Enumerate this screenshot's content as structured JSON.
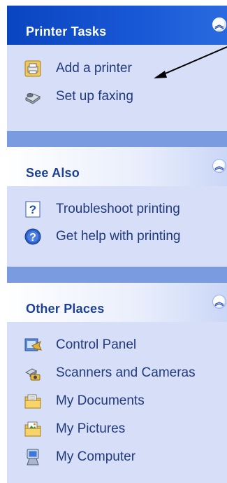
{
  "printer_tasks": {
    "title": "Printer Tasks",
    "collapse_glyph": "︽",
    "items": [
      {
        "label": "Add a printer",
        "icon": "add-printer-icon"
      },
      {
        "label": "Set up faxing",
        "icon": "fax-icon"
      }
    ]
  },
  "see_also": {
    "title": "See Also",
    "collapse_glyph": "︽",
    "items": [
      {
        "label": "Troubleshoot printing",
        "icon": "help-topic-icon"
      },
      {
        "label": "Get help with printing",
        "icon": "help-circle-icon"
      }
    ]
  },
  "other_places": {
    "title": "Other Places",
    "collapse_glyph": "︽",
    "items": [
      {
        "label": "Control Panel",
        "icon": "control-panel-icon"
      },
      {
        "label": "Scanners and Cameras",
        "icon": "scanner-camera-icon"
      },
      {
        "label": "My Documents",
        "icon": "documents-folder-icon"
      },
      {
        "label": "My Pictures",
        "icon": "pictures-folder-icon"
      },
      {
        "label": "My Computer",
        "icon": "computer-icon"
      }
    ]
  },
  "colors": {
    "pane_background": "#7B9BE0",
    "panel_body": "#D6DFF7",
    "special_header": "#0A45C0",
    "link_text": "#22397e"
  }
}
